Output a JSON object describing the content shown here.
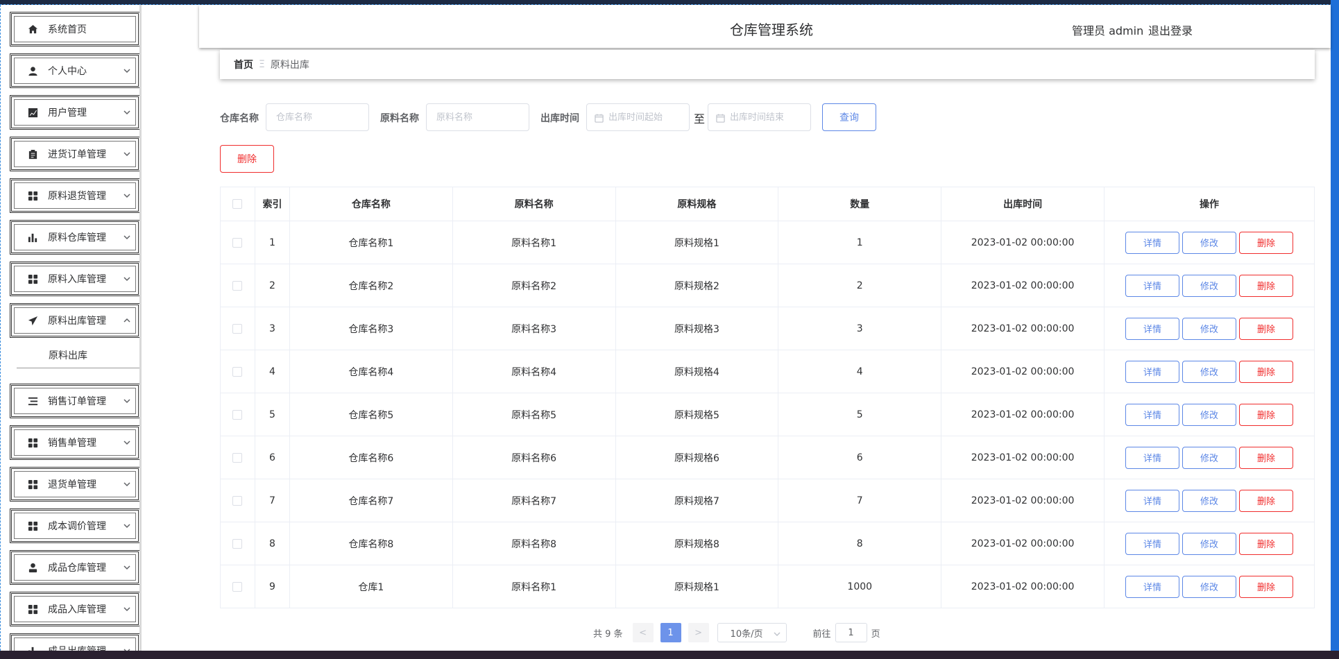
{
  "header": {
    "title": "仓库管理系统",
    "user": "管理员 admin",
    "logout": "退出登录"
  },
  "sidebar": {
    "items": [
      {
        "label": "系统首页",
        "icon": "home-icon"
      },
      {
        "label": "个人中心",
        "icon": "user-icon"
      },
      {
        "label": "用户管理",
        "icon": "chart-line-icon"
      },
      {
        "label": "进货订单管理",
        "icon": "clipboard-icon"
      },
      {
        "label": "原料退货管理",
        "icon": "grid-icon"
      },
      {
        "label": "原料仓库管理",
        "icon": "bar-chart-icon"
      },
      {
        "label": "原料入库管理",
        "icon": "grid-icon"
      },
      {
        "label": "原料出库管理",
        "icon": "send-icon"
      },
      {
        "label": "销售订单管理",
        "icon": "list-icon"
      },
      {
        "label": "销售单管理",
        "icon": "grid-icon"
      },
      {
        "label": "退货单管理",
        "icon": "grid-icon"
      },
      {
        "label": "成本调价管理",
        "icon": "grid-icon"
      },
      {
        "label": "成品仓库管理",
        "icon": "person-icon"
      },
      {
        "label": "成品入库管理",
        "icon": "grid-icon"
      },
      {
        "label": "成品出库管理",
        "icon": "bar-chart-icon"
      }
    ],
    "submenu": "原料出库"
  },
  "breadcrumb": {
    "home": "首页",
    "separator": "Ξ",
    "current": "原料出库"
  },
  "search": {
    "warehouse_label": "仓库名称",
    "warehouse_placeholder": "仓库名称",
    "material_label": "原料名称",
    "material_placeholder": "原料名称",
    "time_label": "出库时间",
    "time_start_placeholder": "出库时间起始",
    "range_sep": "至",
    "time_end_placeholder": "出库时间结束",
    "query_btn": "查询",
    "delete_btn": "删除"
  },
  "table": {
    "headers": [
      "索引",
      "仓库名称",
      "原料名称",
      "原料规格",
      "数量",
      "出库时间",
      "操作"
    ],
    "rows": [
      [
        "1",
        "仓库名称1",
        "原料名称1",
        "原料规格1",
        "1",
        "2023-01-02 00:00:00"
      ],
      [
        "2",
        "仓库名称2",
        "原料名称2",
        "原料规格2",
        "2",
        "2023-01-02 00:00:00"
      ],
      [
        "3",
        "仓库名称3",
        "原料名称3",
        "原料规格3",
        "3",
        "2023-01-02 00:00:00"
      ],
      [
        "4",
        "仓库名称4",
        "原料名称4",
        "原料规格4",
        "4",
        "2023-01-02 00:00:00"
      ],
      [
        "5",
        "仓库名称5",
        "原料名称5",
        "原料规格5",
        "5",
        "2023-01-02 00:00:00"
      ],
      [
        "6",
        "仓库名称6",
        "原料名称6",
        "原料规格6",
        "6",
        "2023-01-02 00:00:00"
      ],
      [
        "7",
        "仓库名称7",
        "原料名称7",
        "原料规格7",
        "7",
        "2023-01-02 00:00:00"
      ],
      [
        "8",
        "仓库名称8",
        "原料名称8",
        "原料规格8",
        "8",
        "2023-01-02 00:00:00"
      ],
      [
        "9",
        "仓库1",
        "原料名称1",
        "原料规格1",
        "1000",
        "2023-01-02 00:00:00"
      ]
    ],
    "actions": {
      "detail": "详情",
      "edit": "修改",
      "delete": "删除"
    }
  },
  "pagination": {
    "total": "共 9 条",
    "prev": "<",
    "current_page": "1",
    "next": ">",
    "page_size": "10条/页",
    "goto_prefix": "前往",
    "goto_value": "1",
    "goto_suffix": "页"
  },
  "colors": {
    "primary": "#5c87e6",
    "danger": "#f02c2c",
    "active_page": "#6d93ea"
  }
}
